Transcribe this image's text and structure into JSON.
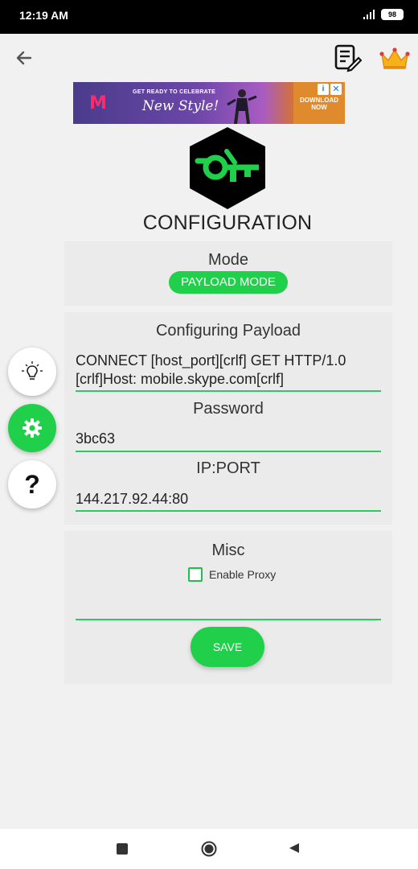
{
  "status_bar": {
    "time": "12:19 AM",
    "battery": "98"
  },
  "ad": {
    "headline": "GET READY TO CELEBRATE",
    "tagline": "New Style!",
    "cta_line1": "DOWNLOAD",
    "cta_line2": "NOW",
    "info_glyph": "i",
    "close_glyph": "✕"
  },
  "page_title": "CONFIGURATION",
  "mode": {
    "heading": "Mode",
    "value": "PAYLOAD MODE"
  },
  "payload": {
    "heading": "Configuring Payload",
    "value_line1": "CONNECT [host_port][crlf] GET HTTP/1.0",
    "value_line2": "[crlf]Host: mobile.skype.com[crlf]"
  },
  "password": {
    "heading": "Password",
    "value": "3bc63"
  },
  "ip_port": {
    "heading": "IP:PORT",
    "value": "144.217.92.44:80"
  },
  "misc": {
    "heading": "Misc",
    "enable_proxy_label": "Enable Proxy",
    "enable_proxy_checked": false
  },
  "save_label": "SAVE",
  "help_glyph": "?",
  "colors": {
    "accent": "#21d04a",
    "logo_bg": "#000000"
  },
  "icons": [
    "back-arrow-icon",
    "notes-edit-icon",
    "crown-icon",
    "lightbulb-icon",
    "gear-icon",
    "question-icon"
  ]
}
